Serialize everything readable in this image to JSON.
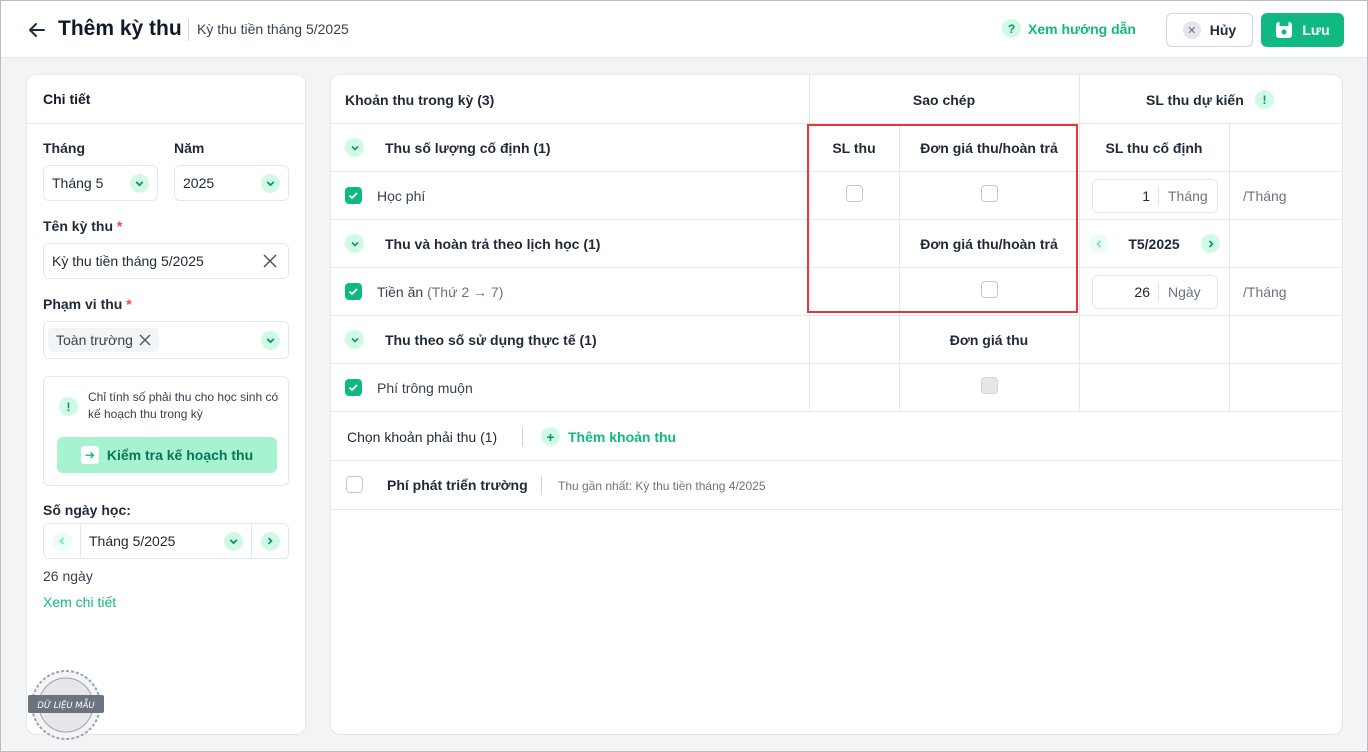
{
  "header": {
    "title": "Thêm kỳ thu",
    "subtitle": "Kỳ thu tiền tháng 5/2025",
    "help_label": "Xem hướng dẫn",
    "cancel_label": "Hủy",
    "save_label": "Lưu",
    "accent": "#10b981"
  },
  "details": {
    "heading": "Chi tiết",
    "month_label": "Tháng",
    "month_value": "Tháng 5",
    "year_label": "Năm",
    "year_value": "2025",
    "name_label": "Tên kỳ thu",
    "name_value": "Kỳ thu tiền tháng 5/2025",
    "scope_label": "Phạm vi thu",
    "scope_chip": "Toàn trường",
    "required_mark": "*",
    "info_text": "Chỉ tính số phải thu cho học sinh có kế hoạch thu trong kỳ",
    "check_plan_label": "Kiểm tra kế hoạch thu",
    "school_days_label": "Số ngày học:",
    "school_days_month": "Tháng 5/2025",
    "school_days_count": "26 ngày",
    "detail_link": "Xem chi tiết",
    "watermark": "DỮ LIỆU MẪU"
  },
  "table": {
    "header": {
      "items": "Khoản thu trong kỳ (3)",
      "copy": "Sao chép",
      "expected": "SL thu dự kiến"
    },
    "group1": {
      "title": "Thu số lượng cố định (1)",
      "col_sl": "SL thu",
      "col_price": "Đơn giá thu/hoàn trả",
      "col_fixed": "SL thu cố định",
      "item": "Học phí",
      "qty": "1",
      "qty_unit": "Tháng",
      "per": "/Tháng"
    },
    "group2": {
      "title": "Thu và hoàn trả theo lịch học (1)",
      "col_price": "Đơn giá thu/hoàn trả",
      "period": "T5/2025",
      "item": "Tiền ăn",
      "item_note": "(Thứ 2 → 7)",
      "qty": "26",
      "qty_unit": "Ngày",
      "per": "/Tháng"
    },
    "group3": {
      "title": "Thu theo số sử dụng thực tế (1)",
      "col_price": "Đơn giá thu",
      "item": "Phí trông muộn"
    },
    "choose_label": "Chọn khoản phải thu (1)",
    "add_label": "Thêm khoản thu",
    "optional_item": "Phí phát triển trường",
    "optional_note": "Thu gần nhất: Kỳ thu tiền tháng 4/2025"
  }
}
